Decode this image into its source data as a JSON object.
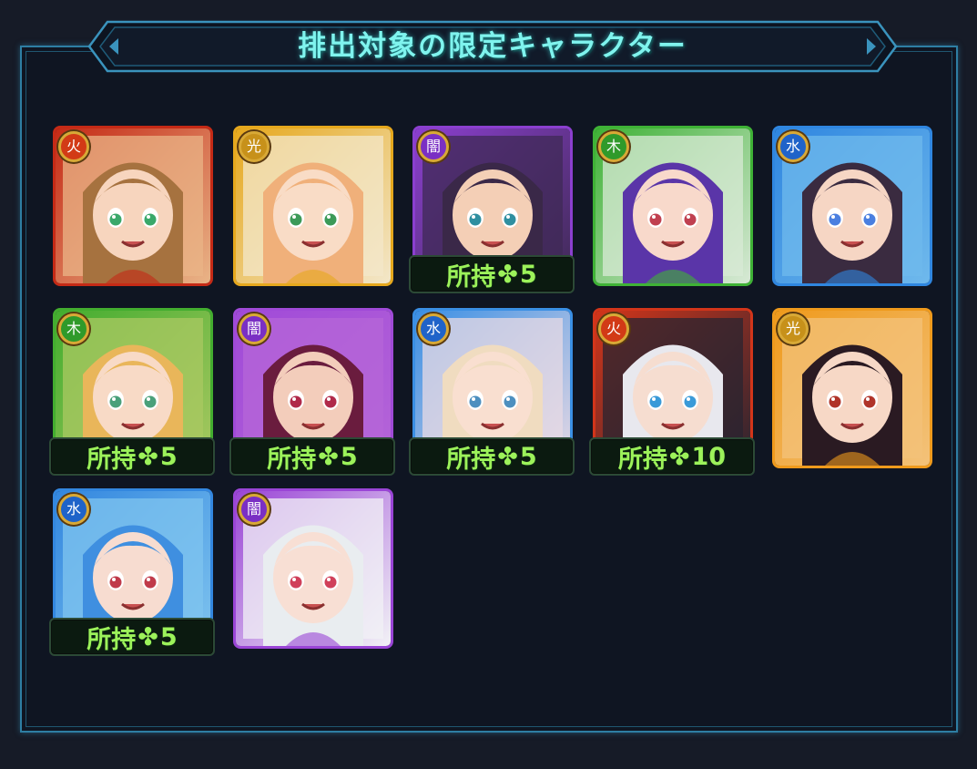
{
  "banner": {
    "title": "排出対象の限定キャラクター"
  },
  "owned_prefix": "所持",
  "clover": "✤",
  "elements": {
    "fire": {
      "color": "#d23a16",
      "glyph": "火",
      "icon": "fire-icon"
    },
    "light": {
      "color": "#c7911a",
      "glyph": "光",
      "icon": "light-icon"
    },
    "dark": {
      "color": "#7a2fc4",
      "glyph": "闇",
      "icon": "dark-icon"
    },
    "wood": {
      "color": "#2f9a2a",
      "glyph": "木",
      "icon": "wood-icon"
    },
    "water": {
      "color": "#1f63c9",
      "glyph": "水",
      "icon": "water-icon"
    }
  },
  "characters": [
    {
      "element": "fire",
      "owned": null,
      "frame": "#c52a16",
      "bg": "#e9b487",
      "hair": "#a6723f",
      "skin": "#f7d5be",
      "eye": "#3aa86a"
    },
    {
      "element": "light",
      "owned": null,
      "frame": "#e6a81d",
      "bg": "#f3e7c9",
      "hair": "#f0b07a",
      "skin": "#f9dcc6",
      "eye": "#3c9a58"
    },
    {
      "element": "dark",
      "owned": "5",
      "frame": "#8b3fcf",
      "bg": "#3f2a55",
      "hair": "#3a2848",
      "skin": "#f4cfb6",
      "eye": "#2f8fa0"
    },
    {
      "element": "wood",
      "owned": null,
      "frame": "#3fb236",
      "bg": "#d8e9d6",
      "hair": "#5a35a8",
      "skin": "#f8d9cb",
      "eye": "#c04050"
    },
    {
      "element": "water",
      "owned": null,
      "frame": "#2f86e0",
      "bg": "#6fb9ec",
      "hair": "#3a2b40",
      "skin": "#f6d6c4",
      "eye": "#4a7fe0"
    },
    {
      "element": "wood",
      "owned": "5",
      "frame": "#43ad2f",
      "bg": "#a9c861",
      "hair": "#e9b65a",
      "skin": "#f8dac6",
      "eye": "#4aa07a"
    },
    {
      "element": "dark",
      "owned": "5",
      "frame": "#a04ad8",
      "bg": "#b565d8",
      "hair": "#6a1c3e",
      "skin": "#f3cdbb",
      "eye": "#b02a4a"
    },
    {
      "element": "water",
      "owned": "5",
      "frame": "#3a8fe4",
      "bg": "#e7d9e4",
      "hair": "#f0dcc0",
      "skin": "#f9dfd0",
      "eye": "#4d8fbf"
    },
    {
      "element": "fire",
      "owned": "10",
      "frame": "#d2351a",
      "bg": "#2a2430",
      "hair": "#e8e8ee",
      "skin": "#f6ddd0",
      "eye": "#3a9ad8"
    },
    {
      "element": "light",
      "owned": null,
      "frame": "#ef9a1c",
      "bg": "#f3c27a",
      "hair": "#2a1a22",
      "skin": "#f7d8c6",
      "eye": "#b0342a"
    },
    {
      "element": "water",
      "owned": "5",
      "frame": "#3387df",
      "bg": "#7fc4ef",
      "hair": "#3f8fe0",
      "skin": "#f7dcd0",
      "eye": "#c03a4a"
    },
    {
      "element": "dark",
      "owned": null,
      "frame": "#9a45d6",
      "bg": "#f2f2f6",
      "hair": "#e9edf0",
      "skin": "#f8dfd4",
      "eye": "#d0405a"
    }
  ]
}
